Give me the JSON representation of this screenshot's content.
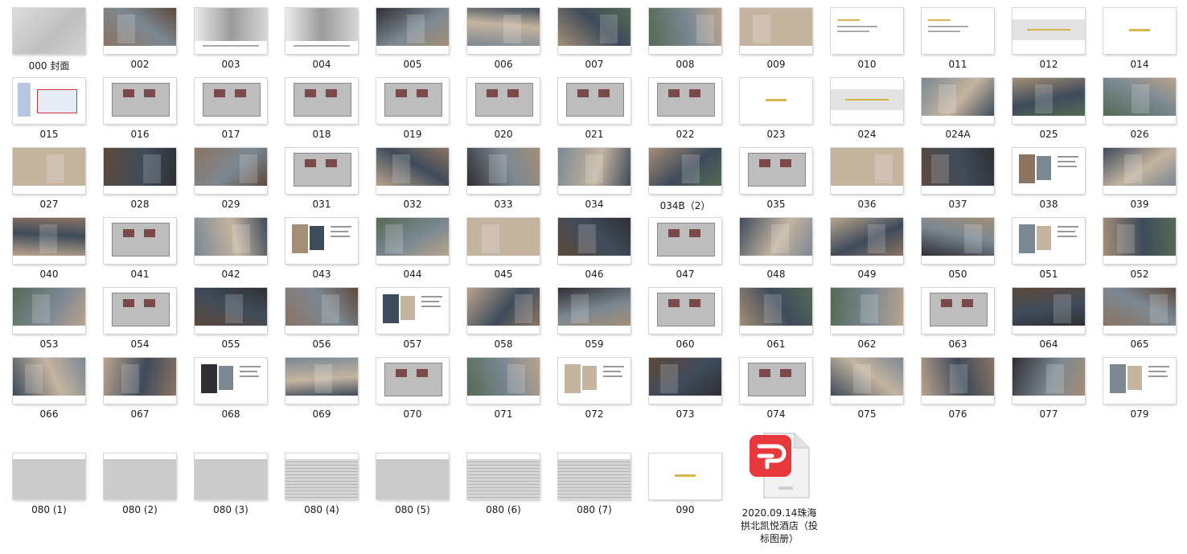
{
  "items": [
    {
      "label": "000 封面",
      "style": "cover"
    },
    {
      "label": "002",
      "style": "photo"
    },
    {
      "label": "003",
      "style": "map"
    },
    {
      "label": "004",
      "style": "map"
    },
    {
      "label": "005",
      "style": "photo"
    },
    {
      "label": "006",
      "style": "photo"
    },
    {
      "label": "007",
      "style": "photo"
    },
    {
      "label": "008",
      "style": "photo"
    },
    {
      "label": "009",
      "style": "photo"
    },
    {
      "label": "010",
      "style": "text"
    },
    {
      "label": "011",
      "style": "text"
    },
    {
      "label": "012",
      "style": "band"
    },
    {
      "label": "014",
      "style": "title"
    },
    {
      "label": "015",
      "style": "chart"
    },
    {
      "label": "016",
      "style": "plan"
    },
    {
      "label": "017",
      "style": "plan"
    },
    {
      "label": "018",
      "style": "plan"
    },
    {
      "label": "019",
      "style": "plan"
    },
    {
      "label": "020",
      "style": "plan"
    },
    {
      "label": "021",
      "style": "plan"
    },
    {
      "label": "022",
      "style": "plan"
    },
    {
      "label": "023",
      "style": "title"
    },
    {
      "label": "024",
      "style": "band"
    },
    {
      "label": "024A",
      "style": "photo"
    },
    {
      "label": "025",
      "style": "photo"
    },
    {
      "label": "026",
      "style": "photo"
    },
    {
      "label": "027",
      "style": "photo"
    },
    {
      "label": "028",
      "style": "photo"
    },
    {
      "label": "029",
      "style": "photo"
    },
    {
      "label": "031",
      "style": "plan"
    },
    {
      "label": "032",
      "style": "photo"
    },
    {
      "label": "033",
      "style": "photo"
    },
    {
      "label": "034",
      "style": "photo"
    },
    {
      "label": "034B（2）",
      "style": "photo"
    },
    {
      "label": "035",
      "style": "plan"
    },
    {
      "label": "036",
      "style": "photo"
    },
    {
      "label": "037",
      "style": "photo"
    },
    {
      "label": "038",
      "style": "material"
    },
    {
      "label": "039",
      "style": "photo"
    },
    {
      "label": "040",
      "style": "photo"
    },
    {
      "label": "041",
      "style": "plan"
    },
    {
      "label": "042",
      "style": "photo"
    },
    {
      "label": "043",
      "style": "material"
    },
    {
      "label": "044",
      "style": "photo"
    },
    {
      "label": "045",
      "style": "photo"
    },
    {
      "label": "046",
      "style": "photo"
    },
    {
      "label": "047",
      "style": "plan"
    },
    {
      "label": "048",
      "style": "photo"
    },
    {
      "label": "049",
      "style": "photo"
    },
    {
      "label": "050",
      "style": "photo"
    },
    {
      "label": "051",
      "style": "material"
    },
    {
      "label": "052",
      "style": "photo"
    },
    {
      "label": "053",
      "style": "photo"
    },
    {
      "label": "054",
      "style": "plan"
    },
    {
      "label": "055",
      "style": "photo"
    },
    {
      "label": "056",
      "style": "photo"
    },
    {
      "label": "057",
      "style": "material"
    },
    {
      "label": "058",
      "style": "photo"
    },
    {
      "label": "059",
      "style": "photo"
    },
    {
      "label": "060",
      "style": "plan"
    },
    {
      "label": "061",
      "style": "photo"
    },
    {
      "label": "062",
      "style": "photo"
    },
    {
      "label": "063",
      "style": "plan"
    },
    {
      "label": "064",
      "style": "photo"
    },
    {
      "label": "065",
      "style": "photo"
    },
    {
      "label": "066",
      "style": "photo"
    },
    {
      "label": "067",
      "style": "photo"
    },
    {
      "label": "068",
      "style": "material"
    },
    {
      "label": "069",
      "style": "photo"
    },
    {
      "label": "070",
      "style": "plan"
    },
    {
      "label": "071",
      "style": "photo"
    },
    {
      "label": "072",
      "style": "material"
    },
    {
      "label": "073",
      "style": "photo"
    },
    {
      "label": "074",
      "style": "plan"
    },
    {
      "label": "075",
      "style": "photo"
    },
    {
      "label": "076",
      "style": "photo"
    },
    {
      "label": "077",
      "style": "photo"
    },
    {
      "label": "079",
      "style": "material"
    },
    {
      "label": "080 (1)",
      "style": "grey"
    },
    {
      "label": "080 (2)",
      "style": "grey"
    },
    {
      "label": "080 (3)",
      "style": "grey"
    },
    {
      "label": "080 (4)",
      "style": "table"
    },
    {
      "label": "080 (5)",
      "style": "grey"
    },
    {
      "label": "080 (6)",
      "style": "table"
    },
    {
      "label": "080 (7)",
      "style": "table"
    },
    {
      "label": "090",
      "style": "title"
    }
  ],
  "pdf_file": {
    "label": "2020.09.14珠海拱北凯悦酒店（投标图册）",
    "icon": "pdf-file-icon",
    "accent": "#e8383d"
  }
}
